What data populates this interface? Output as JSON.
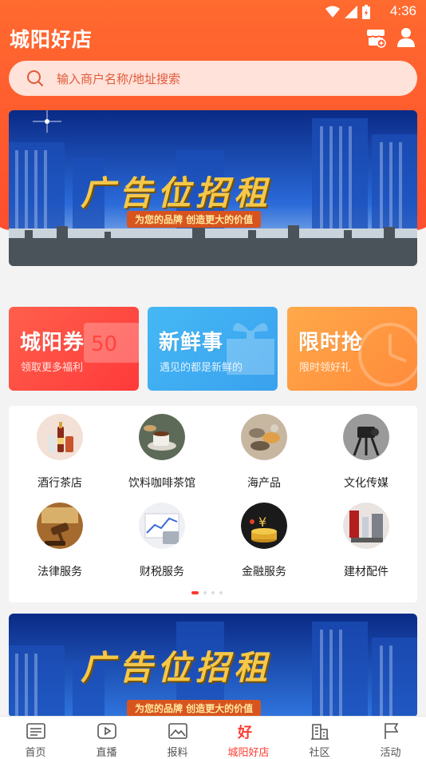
{
  "status": {
    "time": "4:36"
  },
  "header": {
    "title": "城阳好店",
    "shop_icon": "store-icon",
    "user_icon": "user-icon"
  },
  "search": {
    "placeholder": "输入商户名称/地址搜索",
    "icon": "search-icon"
  },
  "banners": [
    {
      "title": "广告位招租",
      "subtitle": "为您的品牌 创造更大的价值"
    },
    {
      "title": "广告位招租",
      "subtitle": "为您的品牌 创造更大的价值"
    }
  ],
  "promos": [
    {
      "title": "城阳券",
      "subtitle": "领取更多福利",
      "color": "#ff4a40"
    },
    {
      "title": "新鲜事",
      "subtitle": "遇见的都是新鲜的",
      "color": "#40acf2"
    },
    {
      "title": "限时抢",
      "subtitle": "限时领好礼",
      "color": "#ff9a42"
    }
  ],
  "categories": [
    {
      "label": "酒行茶店",
      "icon": "liquor-tea-icon"
    },
    {
      "label": "饮料咖啡茶馆",
      "icon": "cafe-icon"
    },
    {
      "label": "海产品",
      "icon": "seafood-icon"
    },
    {
      "label": "文化传媒",
      "icon": "camera-media-icon"
    },
    {
      "label": "法律服务",
      "icon": "gavel-icon"
    },
    {
      "label": "财税服务",
      "icon": "finance-chart-icon"
    },
    {
      "label": "金融服务",
      "icon": "gold-coins-icon"
    },
    {
      "label": "建材配件",
      "icon": "building-materials-icon"
    }
  ],
  "pager": {
    "pages": 4,
    "active": 1
  },
  "tabs": [
    {
      "label": "首页",
      "icon": "home-news-icon",
      "active": false
    },
    {
      "label": "直播",
      "icon": "play-icon",
      "active": false
    },
    {
      "label": "报料",
      "icon": "image-icon",
      "active": false
    },
    {
      "label": "城阳好店",
      "icon": "good-store-icon",
      "active": true
    },
    {
      "label": "社区",
      "icon": "community-icon",
      "active": false
    },
    {
      "label": "活动",
      "icon": "flag-icon",
      "active": false
    }
  ],
  "colors": {
    "accent": "#ff4d2e",
    "active_tab": "#ff3b30"
  }
}
